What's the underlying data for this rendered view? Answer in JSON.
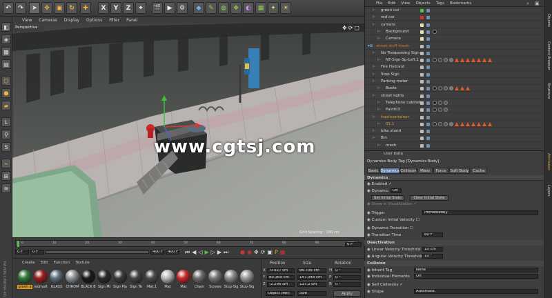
{
  "toolbar": {
    "xyz": [
      "X",
      "Y",
      "Z"
    ]
  },
  "viewport": {
    "menu": [
      "View",
      "Cameras",
      "Display",
      "Options",
      "Filter",
      "Panel"
    ],
    "label": "Perspective",
    "grid_spacing": "Grid Spacing : 100 cm",
    "watermark": "www.cgtsj.com"
  },
  "timeline": {
    "ticks": [
      "0",
      "10",
      "20",
      "30",
      "40",
      "50",
      "60",
      "70",
      "80",
      "90",
      "100"
    ],
    "frame_start": "0 F",
    "frame_current": "0 F",
    "frame_end": "400 F",
    "frame_end2": "400 F",
    "frame_right": "0 F",
    "progress": 0.0
  },
  "materials": {
    "menu": [
      "Create",
      "Edit",
      "Function",
      "Texture"
    ],
    "items": [
      {
        "label": "green a",
        "color": "#2f7a3a"
      },
      {
        "label": "redmatt",
        "color": "#9a1f1f"
      },
      {
        "label": "GLASS",
        "color": "#5d6e78"
      },
      {
        "label": "CHROM",
        "color": "#8f9498"
      },
      {
        "label": "BLACK B",
        "color": "#1a1a1a"
      },
      {
        "label": "Sign Mi",
        "color": "#2a2a2a"
      },
      {
        "label": "Sign Pla",
        "color": "#3a3a3a"
      },
      {
        "label": "Sign Te",
        "color": "#444444"
      },
      {
        "label": "Mat.1",
        "color": "#4b4b4b"
      },
      {
        "label": "Mat",
        "color": "#bbbbbb"
      },
      {
        "label": "Mat",
        "color": "#c62a2a"
      },
      {
        "label": "Chain",
        "color": "#6d6d6d"
      },
      {
        "label": "Screws",
        "color": "#777777"
      },
      {
        "label": "Stop-Sig",
        "color": "#8a8a8a"
      },
      {
        "label": "Stop-Sig",
        "color": "#9a9a9a"
      }
    ],
    "brand": "MAXON CINEMA 4D"
  },
  "coords": {
    "headers": [
      "Position",
      "Size",
      "Rotation"
    ],
    "rows": [
      {
        "axis": "X",
        "pos": "-0.527 cm",
        "size": "86.706 cm",
        "rot_axis": "H",
        "rot": "0 °"
      },
      {
        "axis": "Y",
        "pos": "80.369 cm",
        "size": "147.348 cm",
        "rot_axis": "P",
        "rot": "0 °"
      },
      {
        "axis": "Z",
        "pos": "-2.296 cm",
        "size": "137.2 cm",
        "rot_axis": "B",
        "rot": "0 °"
      }
    ],
    "mode": "Object (Rel)",
    "size_mode": "Size",
    "apply": "Apply"
  },
  "objmgr": {
    "menu": [
      "File",
      "Edit",
      "View",
      "Objects",
      "Tags",
      "Bookmarks"
    ],
    "rows": [
      {
        "name": "green car",
        "indent": 1,
        "color": "#d6d6d6",
        "tags": ""
      },
      {
        "name": "red car",
        "indent": 1,
        "color": "#d6d6d6",
        "tags": ""
      },
      {
        "name": "camera",
        "indent": 1,
        "color": "#d6d6d6",
        "tags": ""
      },
      {
        "name": "Background",
        "indent": 2,
        "color": "#d6d6d6",
        "tags": "bg"
      },
      {
        "name": "Camera",
        "indent": 2,
        "color": "#d6d6d6",
        "tags": ""
      },
      {
        "name": "street stuff mesh",
        "indent": 0,
        "color": "#e07a2c",
        "tags": ""
      },
      {
        "name": "No Trespassing Sign",
        "indent": 1,
        "color": "#d6d6d6",
        "tags": ""
      },
      {
        "name": "NT-Sign-Sp-Left.1",
        "indent": 2,
        "color": "#d6d6d6",
        "tags": "full"
      },
      {
        "name": "Fire Hydrant",
        "indent": 1,
        "color": "#d6d6d6",
        "tags": ""
      },
      {
        "name": "Stop Sign",
        "indent": 1,
        "color": "#d6d6d6",
        "tags": ""
      },
      {
        "name": "Parking meter",
        "indent": 1,
        "color": "#d6d6d6",
        "tags": ""
      },
      {
        "name": "Boole",
        "indent": 2,
        "color": "#d6d6d6",
        "tags": "short"
      },
      {
        "name": "street lights",
        "indent": 1,
        "color": "#d6d6d6",
        "tags": ""
      },
      {
        "name": "Telephone cabinet",
        "indent": 2,
        "color": "#d6d6d6",
        "tags": "few"
      },
      {
        "name": "Paint03",
        "indent": 2,
        "color": "#d6d6d6",
        "tags": "few"
      },
      {
        "name": "trashcontainer",
        "indent": 1,
        "color": "#e0a02c",
        "tags": ""
      },
      {
        "name": "01.1",
        "indent": 2,
        "color": "#e0a02c",
        "tags": "full"
      },
      {
        "name": "bike stand",
        "indent": 1,
        "color": "#d6d6d6",
        "tags": ""
      },
      {
        "name": "Bin",
        "indent": 1,
        "color": "#d6d6d6",
        "tags": ""
      },
      {
        "name": "mesh",
        "indent": 2,
        "color": "#d6d6d6",
        "tags": ""
      }
    ]
  },
  "attr": {
    "menu": [
      "User Data"
    ],
    "title": "Dynamics Body Tag [Dynamics Body]",
    "tabs": [
      "Basic",
      "Dynamics",
      "Collision",
      "Mass",
      "Force",
      "Soft Body",
      "Cache"
    ],
    "active_tab": "Dynamics",
    "section1": "Dynamics",
    "enabled_label": "Enabled",
    "enabled_value": "✓",
    "dynamic_label": "Dynamic",
    "dynamic_value": "On",
    "set_initial": "Set Initial State",
    "clear_initial": "Clear Initial State",
    "show_in_vis": "Show in Visualization",
    "trigger_label": "Trigger",
    "trigger_value": "Immediately",
    "custom_vel": "Custom Initial Velocity",
    "dyn_transition": "Dynamic Transition",
    "transition_time_label": "Transition Time",
    "transition_time_value": "60 F",
    "section2": "Deactivation",
    "linear_label": "Linear Velocity Threshold",
    "linear_value": "10 cm",
    "angular_label": "Angular Velocity Threshold",
    "angular_value": "10 °",
    "section3": "Collision",
    "inherit_label": "Inherit Tag",
    "inherit_value": "None",
    "individual_label": "Individual Elements",
    "individual_value": "Off",
    "self_collisions": "Self Collisions",
    "self_value": "✓",
    "shape_label": "Shape",
    "shape_value": "Automatic"
  },
  "right_strip": [
    "Objects",
    "Content Browser",
    "Structure",
    "Attributes",
    "Layers"
  ]
}
